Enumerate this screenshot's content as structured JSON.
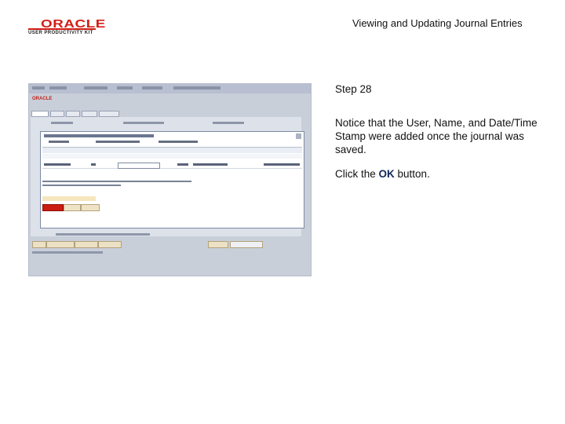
{
  "logo": {
    "brand": "ORACLE",
    "subtitle": "USER PRODUCTIVITY KIT"
  },
  "header": {
    "title": "Viewing and Updating Journal Entries"
  },
  "step": {
    "label": "Step 28"
  },
  "description": "Notice that the User, Name, and Date/Time Stamp were added once the journal was saved.",
  "instruction": {
    "prefix": "Click the ",
    "emphasis": "OK",
    "suffix": " button."
  },
  "colors": {
    "brand": "#d41d15",
    "ok_button": "#cc1d12",
    "emphasis": "#14285a"
  }
}
